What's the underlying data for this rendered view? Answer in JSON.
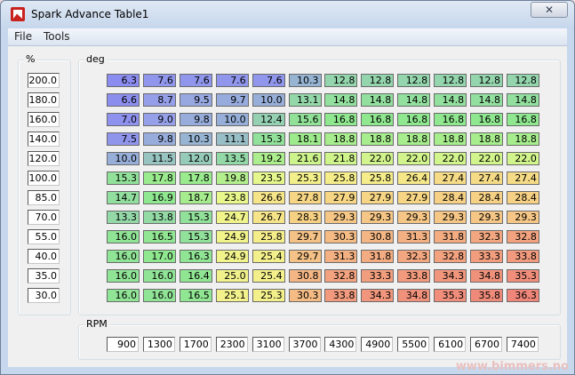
{
  "window": {
    "title": "Spark Advance Table1",
    "close_glyph": "✕"
  },
  "menu": [
    "File",
    "Tools"
  ],
  "load_group": {
    "label": "%",
    "values": [
      "200.0",
      "180.0",
      "160.0",
      "140.0",
      "120.0",
      "100.0",
      "85.0",
      "70.0",
      "55.0",
      "40.0",
      "35.0",
      "30.0"
    ]
  },
  "table_group": {
    "label": "deg",
    "rows": [
      [
        "6.3",
        "7.6",
        "7.6",
        "7.6",
        "7.6",
        "10.3",
        "12.8",
        "12.8",
        "12.8",
        "12.8",
        "12.8",
        "12.8"
      ],
      [
        "6.6",
        "8.7",
        "9.5",
        "9.7",
        "10.0",
        "13.1",
        "14.8",
        "14.8",
        "14.8",
        "14.8",
        "14.8",
        "14.8"
      ],
      [
        "7.0",
        "9.0",
        "9.8",
        "10.0",
        "12.4",
        "15.6",
        "16.8",
        "16.8",
        "16.8",
        "16.8",
        "16.8",
        "16.8"
      ],
      [
        "7.5",
        "9.8",
        "10.3",
        "11.1",
        "15.3",
        "18.1",
        "18.8",
        "18.8",
        "18.8",
        "18.8",
        "18.8",
        "18.8"
      ],
      [
        "10.0",
        "11.5",
        "12.0",
        "13.5",
        "19.2",
        "21.6",
        "21.8",
        "22.0",
        "22.0",
        "22.0",
        "22.0",
        "22.0"
      ],
      [
        "15.3",
        "17.8",
        "17.8",
        "19.8",
        "23.5",
        "25.3",
        "25.8",
        "25.8",
        "26.4",
        "27.4",
        "27.4",
        "27.4"
      ],
      [
        "14.7",
        "16.9",
        "18.7",
        "23.8",
        "26.6",
        "27.8",
        "27.9",
        "27.9",
        "27.9",
        "28.4",
        "28.4",
        "28.4"
      ],
      [
        "13.3",
        "13.8",
        "15.3",
        "24.7",
        "26.7",
        "28.3",
        "29.3",
        "29.3",
        "29.3",
        "29.3",
        "29.3",
        "29.3"
      ],
      [
        "16.0",
        "16.5",
        "15.3",
        "24.9",
        "25.8",
        "29.7",
        "30.3",
        "30.8",
        "31.3",
        "31.8",
        "32.3",
        "32.8"
      ],
      [
        "16.0",
        "17.0",
        "16.3",
        "24.9",
        "25.4",
        "29.7",
        "31.3",
        "31.8",
        "32.3",
        "32.8",
        "33.3",
        "33.8"
      ],
      [
        "16.0",
        "16.0",
        "16.4",
        "25.0",
        "25.4",
        "30.8",
        "32.8",
        "33.3",
        "33.8",
        "34.3",
        "34.8",
        "35.3"
      ],
      [
        "16.0",
        "16.0",
        "16.5",
        "25.1",
        "25.3",
        "30.3",
        "33.8",
        "34.3",
        "34.8",
        "35.3",
        "35.8",
        "36.3"
      ]
    ]
  },
  "rpm_group": {
    "label": "RPM",
    "values": [
      "900",
      "1300",
      "1700",
      "2300",
      "3100",
      "3700",
      "4300",
      "4900",
      "5500",
      "6100",
      "6700",
      "7400"
    ]
  },
  "colors": {
    "cell_low": "#8e8ef2",
    "cell_mid": "#8fe58f",
    "cell_high": "#f2bf86",
    "cell_max": "#f08a82"
  },
  "watermark": "www.bimmers.no"
}
